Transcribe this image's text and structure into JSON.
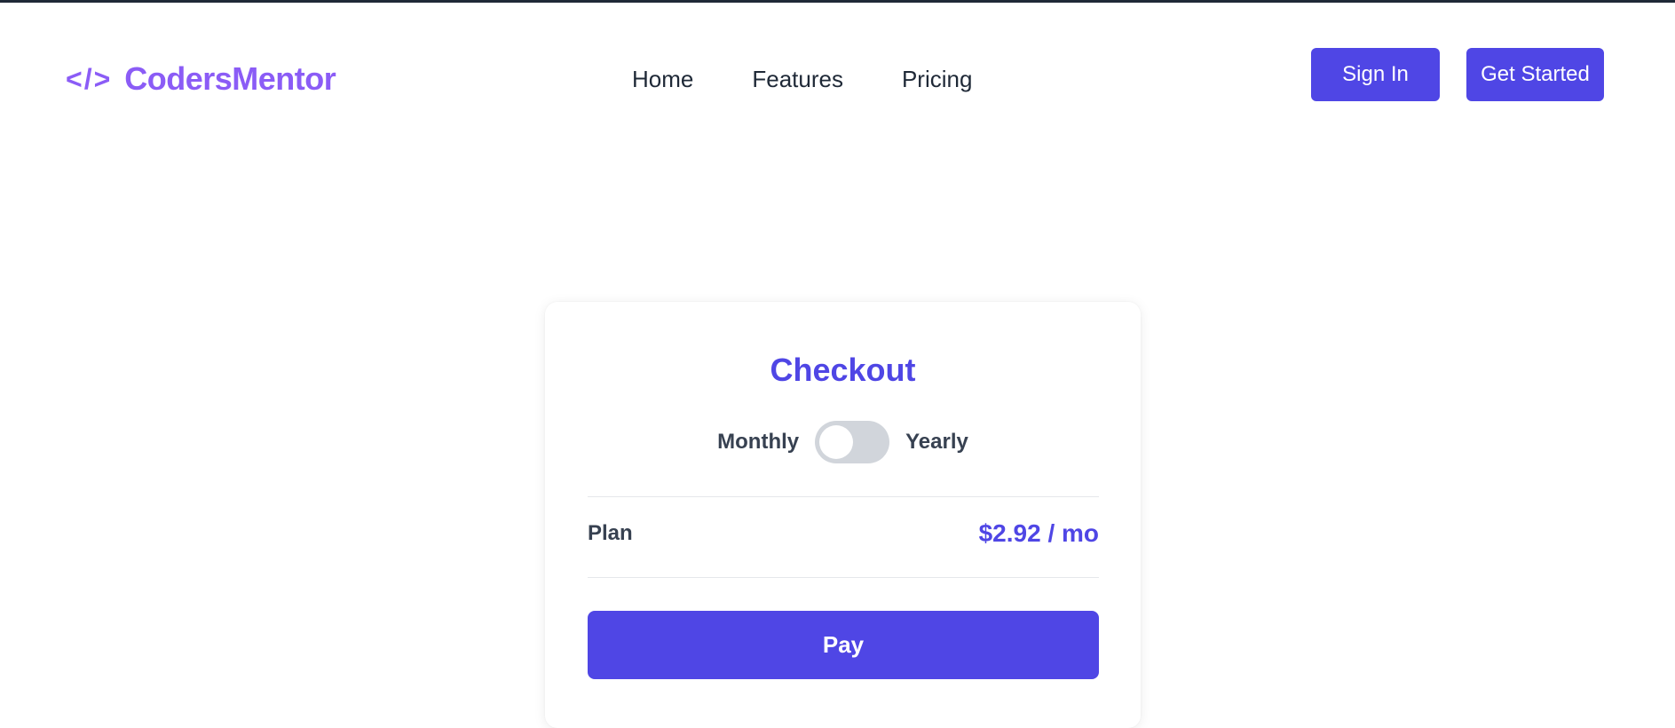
{
  "header": {
    "logo_icon": "</>",
    "logo_text": "CodersMentor",
    "nav": {
      "home": "Home",
      "features": "Features",
      "pricing": "Pricing"
    },
    "sign_in_label": "Sign In",
    "get_started_label": "Get Started"
  },
  "checkout": {
    "title": "Checkout",
    "billing": {
      "monthly_label": "Monthly",
      "yearly_label": "Yearly",
      "yearly_selected": false
    },
    "plan_label": "Plan",
    "plan_price": "$2.92 / mo",
    "pay_label": "Pay"
  },
  "colors": {
    "brand_purple": "#8b5cf6",
    "primary": "#4f46e5",
    "toggle_off": "#d1d5db",
    "top_bar": "#1f2937"
  }
}
